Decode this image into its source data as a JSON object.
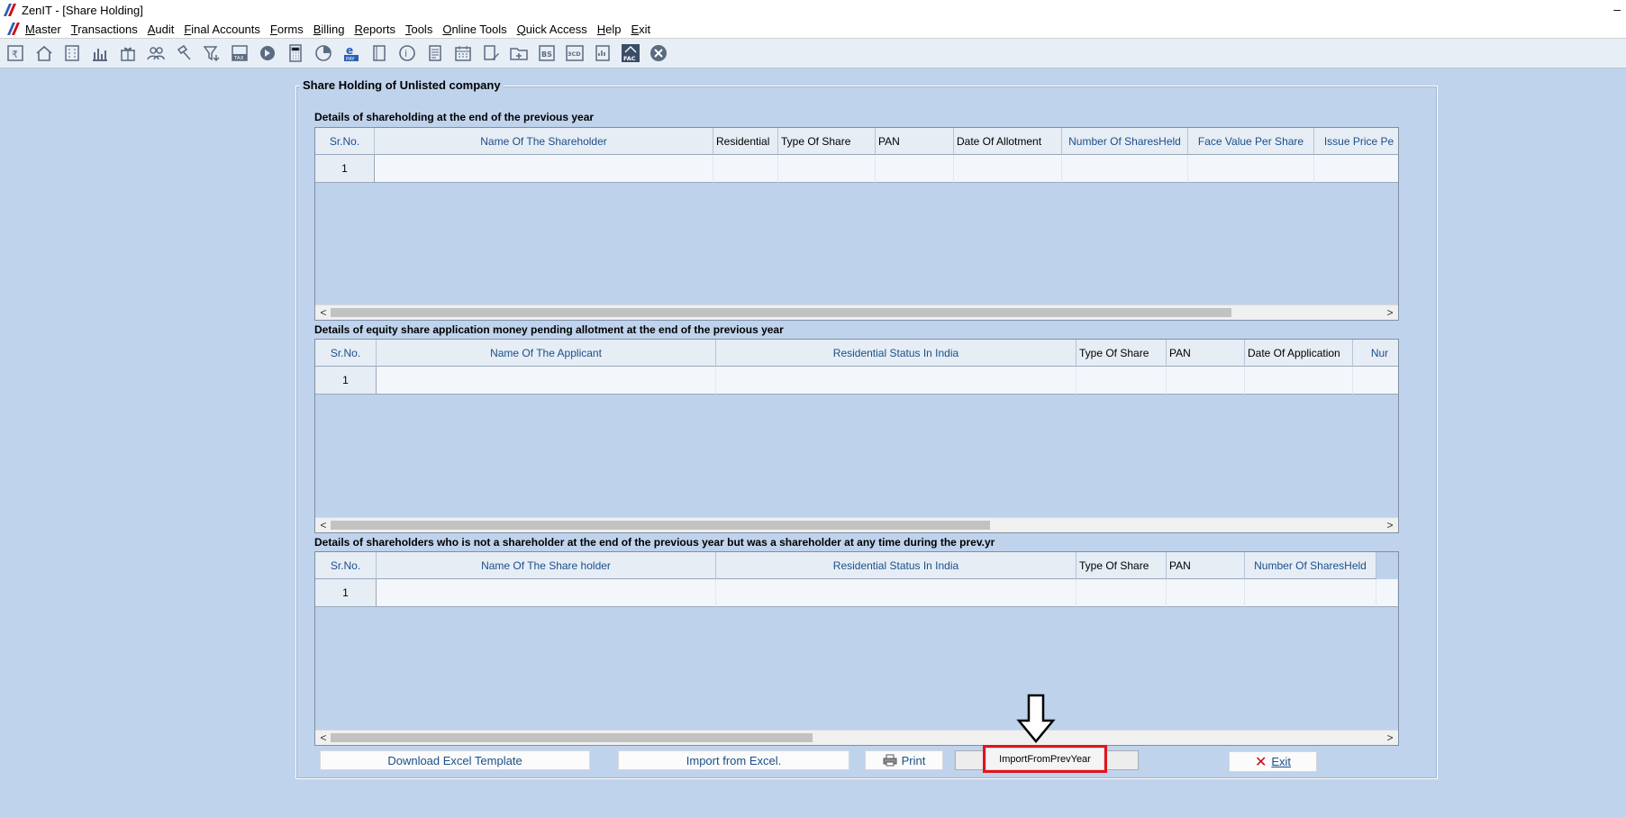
{
  "window": {
    "title": "ZenIT - [Share Holding]",
    "minimize": "–"
  },
  "menu": [
    "Master",
    "Transactions",
    "Audit",
    "Final Accounts",
    "Forms",
    "Billing",
    "Reports",
    "Tools",
    "Online Tools",
    "Quick Access",
    "Help",
    "Exit"
  ],
  "toolbar_icons": [
    "rupee-icon",
    "home-icon",
    "building-icon",
    "bar-chart-icon",
    "gift-icon",
    "users-icon",
    "gavel-icon",
    "filter-icon",
    "tax-icon",
    "arrow-circle-icon",
    "calculator-icon",
    "pie-chart-icon",
    "epay-icon",
    "book-icon",
    "help-icon",
    "document-icon",
    "calendar-icon",
    "edit-doc-icon",
    "folder-add-icon",
    "bs-icon",
    "3cd-icon",
    "report-icon",
    "fac-icon",
    "close-circle-icon"
  ],
  "toolbar_texts": {
    "tax": "TAX",
    "pay": "PAY",
    "bs": "BS",
    "cd": "3CD",
    "fac": "FAC"
  },
  "groupbox": {
    "title": "Share Holding of Unlisted company"
  },
  "sections": [
    {
      "label": "Details of shareholding at the end of the previous year",
      "columns": [
        "Sr.No.",
        "Name Of The Shareholder",
        "Residential",
        "Type Of Share",
        "PAN",
        "Date Of Allotment",
        "Number Of SharesHeld",
        "Face Value Per Share",
        "Issue Price Pe"
      ],
      "rows": [
        "1"
      ]
    },
    {
      "label": "Details of equity share application money pending allotment at the end of the previous year",
      "columns": [
        "Sr.No.",
        "Name Of The Applicant",
        "Residential Status In India",
        "Type Of Share",
        "PAN",
        "Date Of Application",
        "Nur"
      ],
      "rows": [
        "1"
      ]
    },
    {
      "label": "Details of shareholders who is not a shareholder at the end of the previous year but was a shareholder at any time during the prev.yr",
      "columns": [
        "Sr.No.",
        "Name Of The Share holder",
        "Residential Status In India",
        "Type Of Share",
        "PAN",
        "Number Of SharesHeld"
      ],
      "rows": [
        "1"
      ]
    }
  ],
  "scroll": {
    "left": "<",
    "right": ">"
  },
  "buttons": {
    "download": "Download Excel Template",
    "import_excel": "Import from Excel.",
    "print": "Print",
    "import_prev": "ImportFromPrevYear",
    "exit": "Exit"
  },
  "colors": {
    "background": "#bfd3ec",
    "highlight": "#e1141e",
    "exit_x": "#d0021b",
    "header_text": "#1b4f8a"
  }
}
